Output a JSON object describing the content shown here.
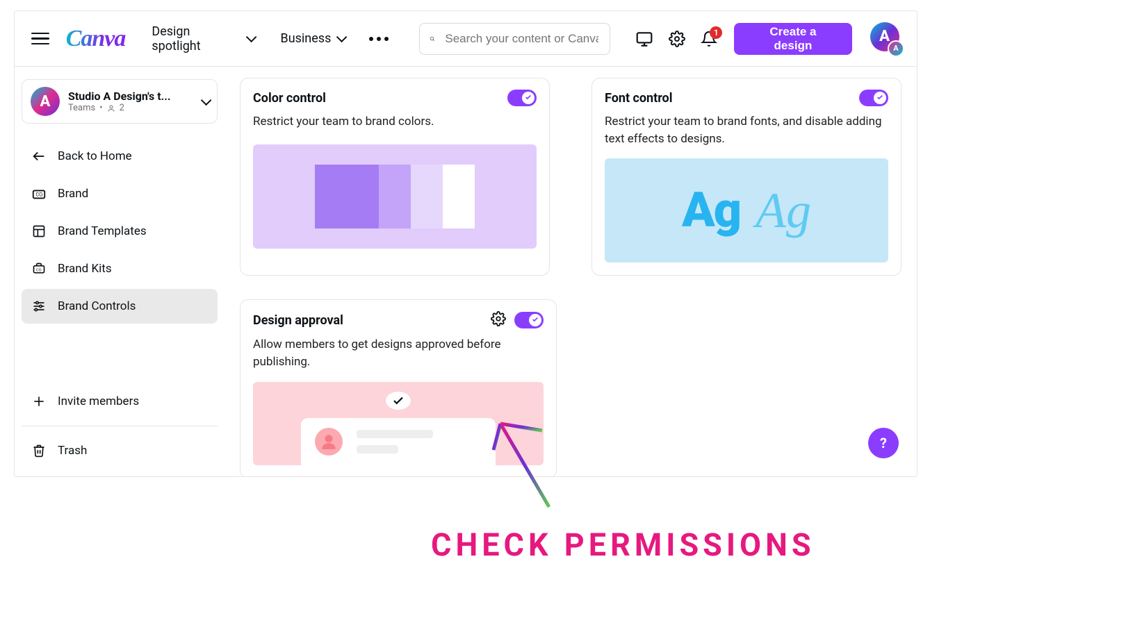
{
  "header": {
    "logo": "Canva",
    "nav": {
      "design_spotlight": "Design spotlight",
      "business": "Business"
    },
    "search_placeholder": "Search your content or Canva's",
    "create_label": "Create a design",
    "notif_count": "1",
    "avatar_letter": "A",
    "avatar_small_letter": "A"
  },
  "sidebar": {
    "team_name": "Studio A Design's t...",
    "team_meta_label": "Teams",
    "team_member_count": "2",
    "back": "Back to Home",
    "items": {
      "brand": "Brand",
      "brand_templates": "Brand Templates",
      "brand_kits": "Brand Kits",
      "brand_controls": "Brand Controls"
    },
    "invite": "Invite members",
    "trash": "Trash"
  },
  "cards": {
    "color": {
      "title": "Color control",
      "desc": "Restrict your team to brand colors."
    },
    "font": {
      "title": "Font control",
      "desc": "Restrict your team to brand fonts, and disable adding text effects to designs.",
      "sample1": "Ag",
      "sample2": "Ag"
    },
    "approval": {
      "title": "Design approval",
      "desc": "Allow members to get designs approved before publishing."
    }
  },
  "help_label": "?",
  "annotation": "CHECK PERMISSIONS"
}
